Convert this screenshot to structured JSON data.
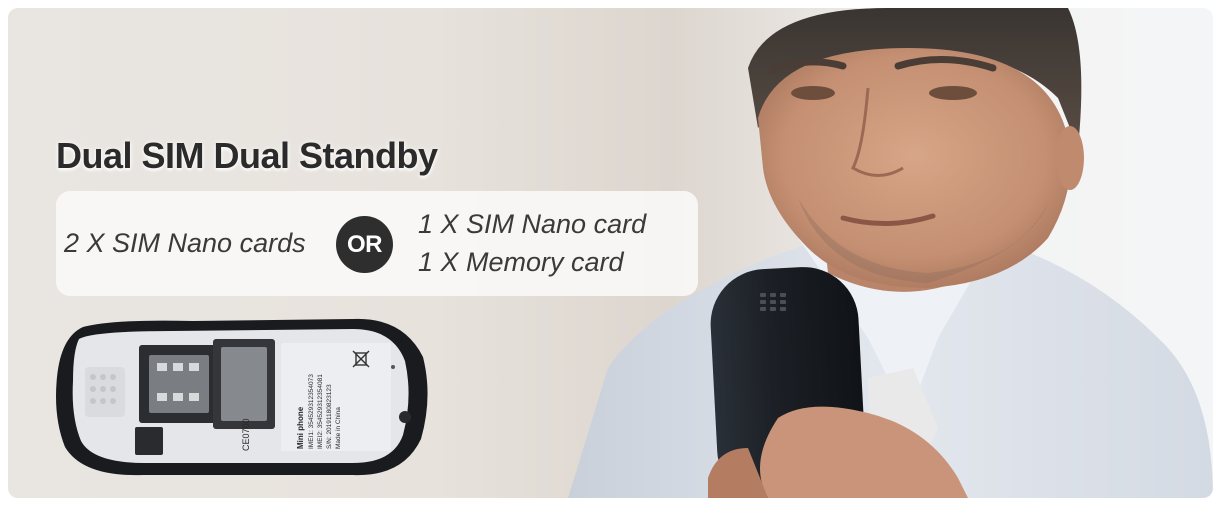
{
  "banner": {
    "headline": "Dual SIM Dual Standby",
    "option_a": "2 X SIM Nano cards",
    "or_label": "OR",
    "option_b_lines": [
      "1 X SIM Nano card",
      "1 X Memory card"
    ]
  },
  "phone_label": {
    "model": "Mini phone",
    "imei1": "IMEI1: 354529312354073",
    "imei2": "IMEI2: 354529312354081",
    "serial": "S/N: 20191180823123",
    "origin": "Made in China",
    "ce_mark": "CE0700"
  },
  "colors": {
    "headline": "#2b2b2b",
    "option_text": "#3a3a3a",
    "or_badge": "#2e2e2e",
    "phone_body": "#1c2026",
    "shirt": "#d7dde6"
  },
  "icons": [
    "weee-bin-icon",
    "speaker-grille-icon"
  ]
}
